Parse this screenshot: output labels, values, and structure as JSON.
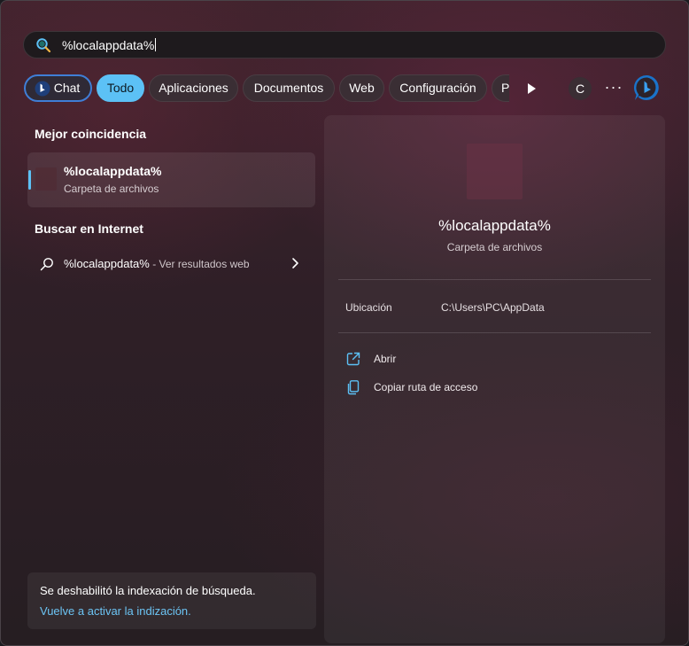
{
  "search": {
    "query": "%localappdata%"
  },
  "filters": {
    "chat": "Chat",
    "all": "Todo",
    "apps": "Aplicaciones",
    "documents": "Documentos",
    "web": "Web",
    "settings": "Configuración",
    "partial": "P",
    "c_button": "C",
    "more": "···"
  },
  "results": {
    "best_match_title": "Mejor coincidencia",
    "best_match": {
      "name": "%localappdata%",
      "type": "Carpeta de archivos"
    },
    "web_title": "Buscar en Internet",
    "web_result": {
      "query": "%localappdata%",
      "suffix": " - Ver resultados web"
    }
  },
  "notice": {
    "message": "Se deshabilitó la indexación de búsqueda.",
    "link": "Vuelve a activar la indización."
  },
  "detail": {
    "name": "%localappdata%",
    "type": "Carpeta de archivos",
    "location_label": "Ubicación",
    "location_value": "C:\\Users\\PC\\AppData",
    "actions": {
      "open": "Abrir",
      "copy_path": "Copiar ruta de acceso"
    }
  },
  "colors": {
    "accent": "#5cc1f6",
    "link": "#6cc4f4",
    "chat_border": "#3f7ed6"
  },
  "icons": [
    "search-icon",
    "bing-chat-icon",
    "play-icon",
    "more-icon",
    "bing-icon",
    "folder-icon",
    "chevron-right-icon",
    "open-external-icon",
    "copy-icon"
  ]
}
